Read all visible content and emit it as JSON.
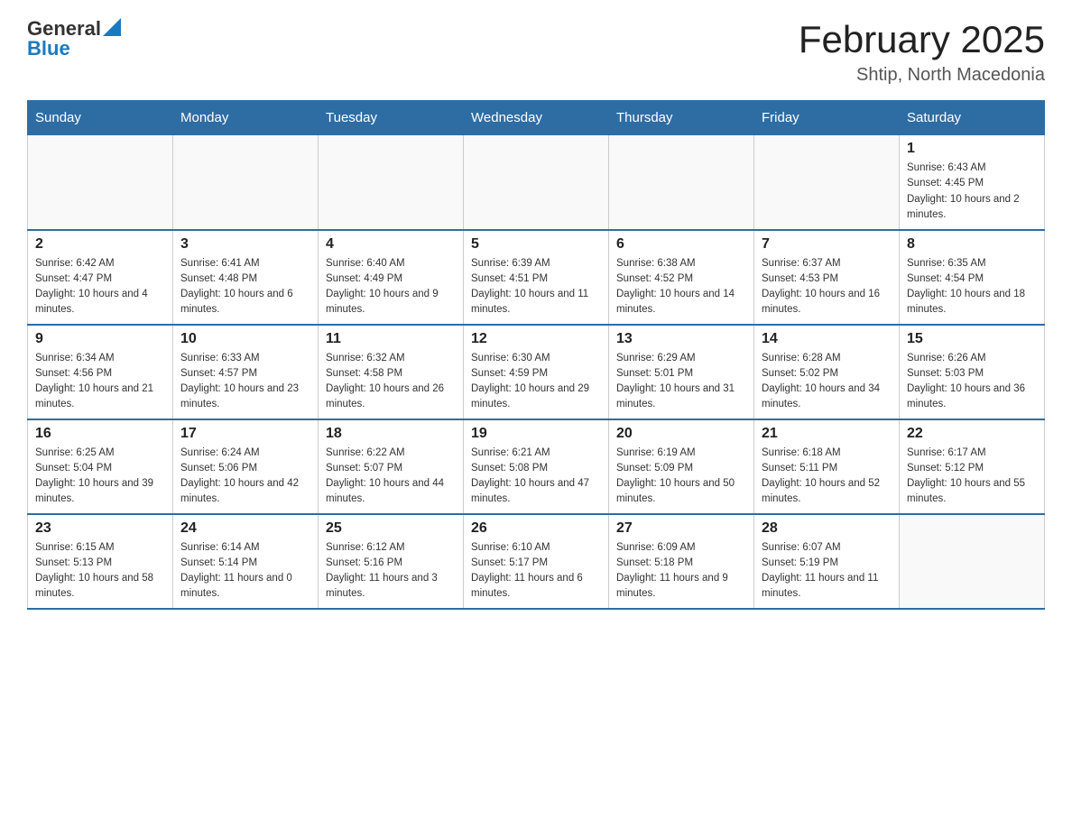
{
  "header": {
    "logo_general": "General",
    "logo_blue": "Blue",
    "month_title": "February 2025",
    "location": "Shtip, North Macedonia"
  },
  "days_of_week": [
    "Sunday",
    "Monday",
    "Tuesday",
    "Wednesday",
    "Thursday",
    "Friday",
    "Saturday"
  ],
  "weeks": [
    [
      {
        "day": "",
        "info": ""
      },
      {
        "day": "",
        "info": ""
      },
      {
        "day": "",
        "info": ""
      },
      {
        "day": "",
        "info": ""
      },
      {
        "day": "",
        "info": ""
      },
      {
        "day": "",
        "info": ""
      },
      {
        "day": "1",
        "info": "Sunrise: 6:43 AM\nSunset: 4:45 PM\nDaylight: 10 hours and 2 minutes."
      }
    ],
    [
      {
        "day": "2",
        "info": "Sunrise: 6:42 AM\nSunset: 4:47 PM\nDaylight: 10 hours and 4 minutes."
      },
      {
        "day": "3",
        "info": "Sunrise: 6:41 AM\nSunset: 4:48 PM\nDaylight: 10 hours and 6 minutes."
      },
      {
        "day": "4",
        "info": "Sunrise: 6:40 AM\nSunset: 4:49 PM\nDaylight: 10 hours and 9 minutes."
      },
      {
        "day": "5",
        "info": "Sunrise: 6:39 AM\nSunset: 4:51 PM\nDaylight: 10 hours and 11 minutes."
      },
      {
        "day": "6",
        "info": "Sunrise: 6:38 AM\nSunset: 4:52 PM\nDaylight: 10 hours and 14 minutes."
      },
      {
        "day": "7",
        "info": "Sunrise: 6:37 AM\nSunset: 4:53 PM\nDaylight: 10 hours and 16 minutes."
      },
      {
        "day": "8",
        "info": "Sunrise: 6:35 AM\nSunset: 4:54 PM\nDaylight: 10 hours and 18 minutes."
      }
    ],
    [
      {
        "day": "9",
        "info": "Sunrise: 6:34 AM\nSunset: 4:56 PM\nDaylight: 10 hours and 21 minutes."
      },
      {
        "day": "10",
        "info": "Sunrise: 6:33 AM\nSunset: 4:57 PM\nDaylight: 10 hours and 23 minutes."
      },
      {
        "day": "11",
        "info": "Sunrise: 6:32 AM\nSunset: 4:58 PM\nDaylight: 10 hours and 26 minutes."
      },
      {
        "day": "12",
        "info": "Sunrise: 6:30 AM\nSunset: 4:59 PM\nDaylight: 10 hours and 29 minutes."
      },
      {
        "day": "13",
        "info": "Sunrise: 6:29 AM\nSunset: 5:01 PM\nDaylight: 10 hours and 31 minutes."
      },
      {
        "day": "14",
        "info": "Sunrise: 6:28 AM\nSunset: 5:02 PM\nDaylight: 10 hours and 34 minutes."
      },
      {
        "day": "15",
        "info": "Sunrise: 6:26 AM\nSunset: 5:03 PM\nDaylight: 10 hours and 36 minutes."
      }
    ],
    [
      {
        "day": "16",
        "info": "Sunrise: 6:25 AM\nSunset: 5:04 PM\nDaylight: 10 hours and 39 minutes."
      },
      {
        "day": "17",
        "info": "Sunrise: 6:24 AM\nSunset: 5:06 PM\nDaylight: 10 hours and 42 minutes."
      },
      {
        "day": "18",
        "info": "Sunrise: 6:22 AM\nSunset: 5:07 PM\nDaylight: 10 hours and 44 minutes."
      },
      {
        "day": "19",
        "info": "Sunrise: 6:21 AM\nSunset: 5:08 PM\nDaylight: 10 hours and 47 minutes."
      },
      {
        "day": "20",
        "info": "Sunrise: 6:19 AM\nSunset: 5:09 PM\nDaylight: 10 hours and 50 minutes."
      },
      {
        "day": "21",
        "info": "Sunrise: 6:18 AM\nSunset: 5:11 PM\nDaylight: 10 hours and 52 minutes."
      },
      {
        "day": "22",
        "info": "Sunrise: 6:17 AM\nSunset: 5:12 PM\nDaylight: 10 hours and 55 minutes."
      }
    ],
    [
      {
        "day": "23",
        "info": "Sunrise: 6:15 AM\nSunset: 5:13 PM\nDaylight: 10 hours and 58 minutes."
      },
      {
        "day": "24",
        "info": "Sunrise: 6:14 AM\nSunset: 5:14 PM\nDaylight: 11 hours and 0 minutes."
      },
      {
        "day": "25",
        "info": "Sunrise: 6:12 AM\nSunset: 5:16 PM\nDaylight: 11 hours and 3 minutes."
      },
      {
        "day": "26",
        "info": "Sunrise: 6:10 AM\nSunset: 5:17 PM\nDaylight: 11 hours and 6 minutes."
      },
      {
        "day": "27",
        "info": "Sunrise: 6:09 AM\nSunset: 5:18 PM\nDaylight: 11 hours and 9 minutes."
      },
      {
        "day": "28",
        "info": "Sunrise: 6:07 AM\nSunset: 5:19 PM\nDaylight: 11 hours and 11 minutes."
      },
      {
        "day": "",
        "info": ""
      }
    ]
  ]
}
